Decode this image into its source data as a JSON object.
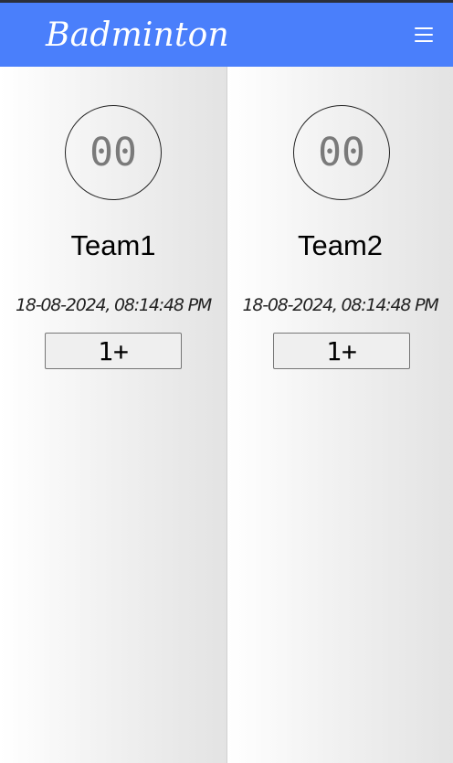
{
  "header": {
    "title": "Badminton",
    "menu_icon": "hamburger-menu-icon"
  },
  "colors": {
    "header_bg": "#4a7ffb",
    "header_text": "#ffffff",
    "score_text": "#7a7a7a"
  },
  "teams": [
    {
      "score": "00",
      "name": "Team1",
      "timestamp": "18-08-2024, 08:14:48 PM",
      "increment_label": "1+"
    },
    {
      "score": "00",
      "name": "Team2",
      "timestamp": "18-08-2024, 08:14:48 PM",
      "increment_label": "1+"
    }
  ]
}
